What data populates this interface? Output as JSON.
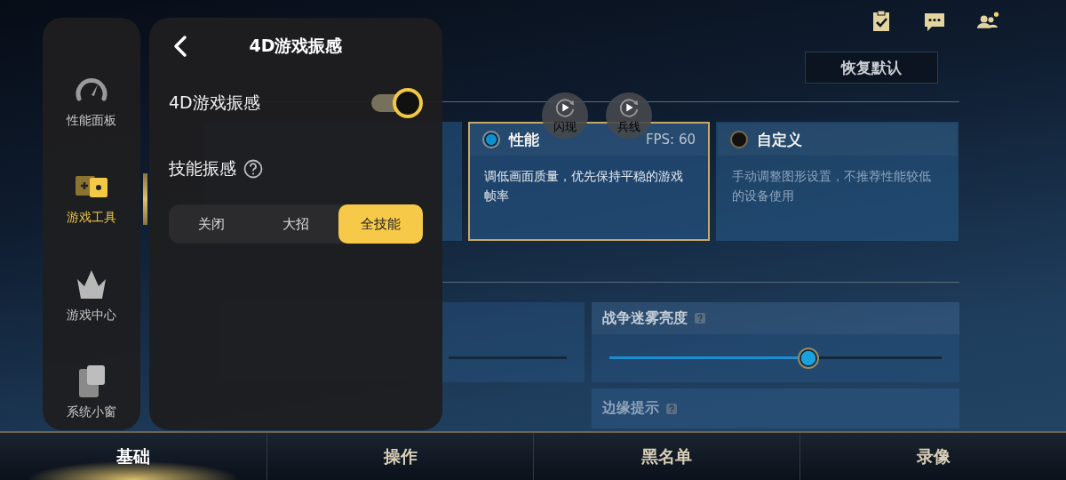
{
  "restore_button": "恢复默认",
  "mode_cards": [
    {
      "title": "性能",
      "fps": "FPS: 60",
      "description": "调低画面质量，优先保持平稳的游戏帧率",
      "selected": true
    },
    {
      "title": "自定义",
      "description": "手动调整图形设置，不推荐性能较低的设备使用",
      "selected": false
    }
  ],
  "replay_bubbles": [
    {
      "label": "闪现"
    },
    {
      "label": "兵线"
    }
  ],
  "sliders": [
    {
      "label": "战争迷雾亮度",
      "level": 0.6
    }
  ],
  "hint_row": {
    "label": "边缘提示"
  },
  "bottom_tabs": [
    {
      "label": "基础",
      "selected": true
    },
    {
      "label": "操作",
      "selected": false
    },
    {
      "label": "黑名单",
      "selected": false
    },
    {
      "label": "录像",
      "selected": false
    }
  ],
  "sidebar": {
    "items": [
      {
        "label": "性能面板",
        "kind": "gauge",
        "selected": false
      },
      {
        "label": "游戏工具",
        "kind": "toolbox",
        "selected": true
      },
      {
        "label": "游戏中心",
        "kind": "crown",
        "selected": false
      },
      {
        "label": "系统小窗",
        "kind": "windows",
        "selected": false
      }
    ]
  },
  "panel": {
    "title": "4D游戏振感",
    "toggle": {
      "label": "4D游戏振感",
      "on": true
    },
    "vibration": {
      "label": "技能振感",
      "options": [
        {
          "label": "关闭",
          "selected": false
        },
        {
          "label": "大招",
          "selected": false
        },
        {
          "label": "全技能",
          "selected": true
        }
      ]
    }
  }
}
